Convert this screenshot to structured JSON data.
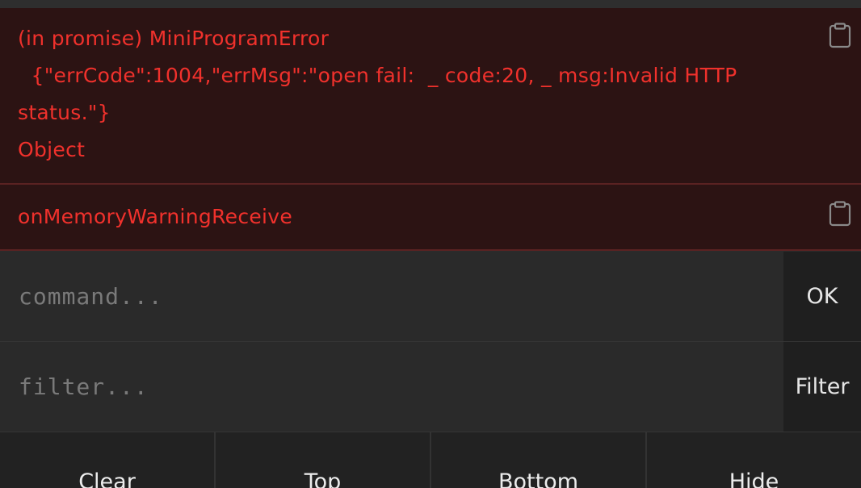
{
  "console": {
    "entries": [
      {
        "lines": [
          "(in promise) MiniProgramError",
          "  {\"errCode\":1004,\"errMsg\":\"open fail:  _ code:20, _ msg:Invalid HTTP",
          "status.\"}",
          "Object"
        ],
        "copy_icon": "clipboard-icon"
      },
      {
        "lines": [
          "onMemoryWarningReceive"
        ],
        "copy_icon": "clipboard-icon"
      }
    ]
  },
  "command": {
    "placeholder": "command...",
    "value": "",
    "ok_label": "OK"
  },
  "filter": {
    "placeholder": "filter...",
    "value": "",
    "filter_label": "Filter"
  },
  "toolbar": {
    "clear_label": "Clear",
    "top_label": "Top",
    "bottom_label": "Bottom",
    "hide_label": "Hide"
  },
  "colors": {
    "error_text": "#f0312c",
    "error_background": "#2c1313",
    "error_border": "#5a2222",
    "panel_background": "#2a2a2a"
  }
}
